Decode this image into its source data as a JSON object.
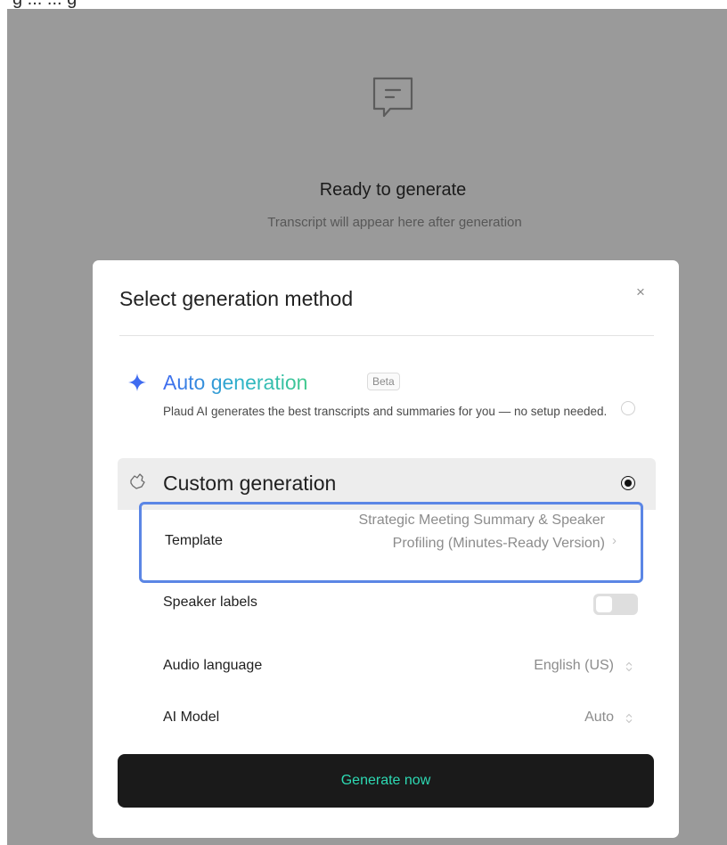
{
  "window": {
    "title": "Ready to generate"
  },
  "top_caption": "g ...  ... g",
  "empty_state": {
    "title": "Ready to generate",
    "subtitle": "Transcript will appear here after generation",
    "icon": "chat-note-icon"
  },
  "modal": {
    "title": "Select generation method",
    "close_label": "×",
    "auto": {
      "title": "Auto generation",
      "badge": "Beta",
      "description": "Plaud AI generates the best transcripts and summaries for you — no setup needed.",
      "selected": false,
      "icon": "sparkle-icon",
      "gradient": [
        "#3f6bf0",
        "#2cb4c8",
        "#41c98d"
      ]
    },
    "custom": {
      "title": "Custom generation",
      "selected": true,
      "icon": "hand-icon",
      "template": {
        "label": "Template",
        "value": "Strategic Meeting Summary & Speaker Profiling (Minutes-Ready Version)"
      },
      "speaker_labels": {
        "label": "Speaker labels",
        "enabled": false
      },
      "audio_language": {
        "label": "Audio language",
        "value": "English (US)"
      },
      "ai_model": {
        "label": "AI Model",
        "value": "Auto"
      }
    },
    "generate_label": "Generate now"
  },
  "colors": {
    "backdrop": "#9a9a9a",
    "highlight_border": "#5b86e5",
    "button_bg": "#1a1a1a",
    "button_text": "#2dd9b3"
  }
}
